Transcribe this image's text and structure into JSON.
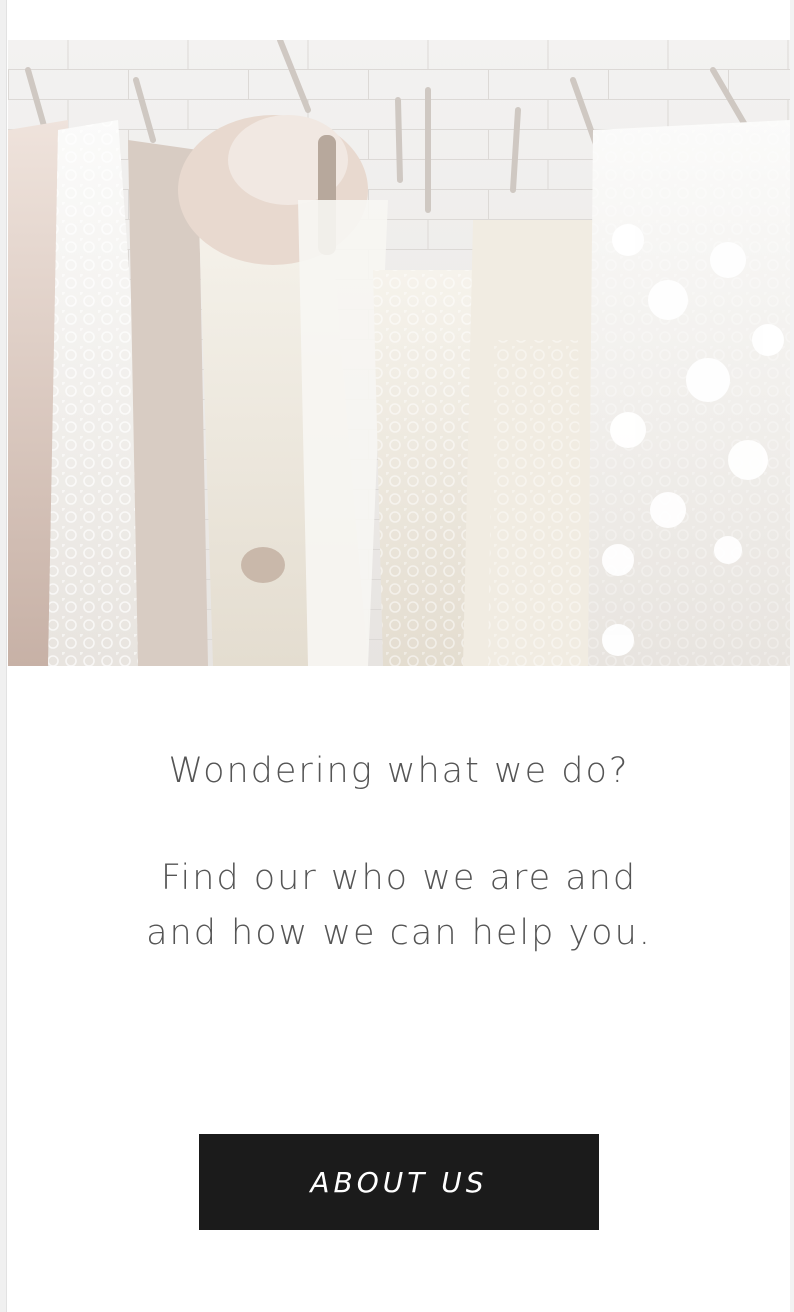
{
  "hero": {
    "image_label": "dresses-on-hangers-photo"
  },
  "intro": {
    "question": "Wondering what we do?",
    "description": "Find our who we are and and how we can help you."
  },
  "cta": {
    "label": "ABOUT US"
  },
  "colors": {
    "text": "#555555",
    "button_bg": "#1b1b1b",
    "button_text": "#ffffff",
    "page_bg": "#ffffff"
  }
}
